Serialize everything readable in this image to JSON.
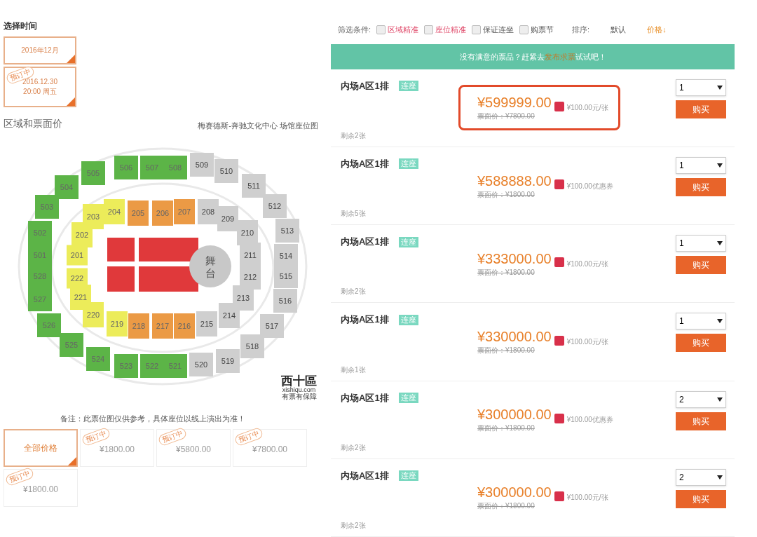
{
  "time_picker": {
    "title": "选择时间",
    "options": [
      {
        "lines": [
          "2016年12月"
        ],
        "selected": true
      },
      {
        "lines": [
          "2016.12.30",
          "20:00 周五"
        ],
        "selected": true,
        "stamp": "预订中"
      }
    ]
  },
  "area": {
    "title": "区域和票面价",
    "venue_link": "梅赛德斯-奔驰文化中心 场馆座位图"
  },
  "seat_map": {
    "stage": "舞台",
    "sections": [
      {
        "label": "505",
        "color": "#5cb447"
      },
      {
        "label": "506",
        "color": "#5cb447"
      },
      {
        "label": "507",
        "color": "#5cb447"
      },
      {
        "label": "508",
        "color": "#5cb447"
      },
      {
        "label": "509",
        "color": "#cfcfcf"
      },
      {
        "label": "510",
        "color": "#cfcfcf"
      },
      {
        "label": "504",
        "color": "#5cb447"
      },
      {
        "label": "511",
        "color": "#cfcfcf"
      },
      {
        "label": "503",
        "color": "#5cb447"
      },
      {
        "label": "203",
        "color": "#ecec5a"
      },
      {
        "label": "204",
        "color": "#ecec5a"
      },
      {
        "label": "205",
        "color": "#eb9a45"
      },
      {
        "label": "206",
        "color": "#eb9a45"
      },
      {
        "label": "207",
        "color": "#eb9a45"
      },
      {
        "label": "208",
        "color": "#cfcfcf"
      },
      {
        "label": "209",
        "color": "#cfcfcf"
      },
      {
        "label": "512",
        "color": "#cfcfcf"
      },
      {
        "label": "502",
        "color": "#5cb447"
      },
      {
        "label": "202",
        "color": "#ecec5a"
      },
      {
        "label": "210",
        "color": "#cfcfcf"
      },
      {
        "label": "513",
        "color": "#cfcfcf"
      },
      {
        "label": "501",
        "color": "#5cb447"
      },
      {
        "label": "201",
        "color": "#ecec5a"
      },
      {
        "label": "211",
        "color": "#cfcfcf"
      },
      {
        "label": "514",
        "color": "#cfcfcf"
      },
      {
        "label": "528",
        "color": "#5cb447"
      },
      {
        "label": "222",
        "color": "#ecec5a"
      },
      {
        "label": "212",
        "color": "#cfcfcf"
      },
      {
        "label": "515",
        "color": "#cfcfcf"
      },
      {
        "label": "527",
        "color": "#5cb447"
      },
      {
        "label": "221",
        "color": "#ecec5a"
      },
      {
        "label": "213",
        "color": "#cfcfcf"
      },
      {
        "label": "516",
        "color": "#cfcfcf"
      },
      {
        "label": "526",
        "color": "#5cb447"
      },
      {
        "label": "220",
        "color": "#ecec5a"
      },
      {
        "label": "219",
        "color": "#ecec5a"
      },
      {
        "label": "218",
        "color": "#eb9a45"
      },
      {
        "label": "217",
        "color": "#eb9a45"
      },
      {
        "label": "216",
        "color": "#eb9a45"
      },
      {
        "label": "215",
        "color": "#cfcfcf"
      },
      {
        "label": "214",
        "color": "#cfcfcf"
      },
      {
        "label": "517",
        "color": "#cfcfcf"
      },
      {
        "label": "525",
        "color": "#5cb447"
      },
      {
        "label": "518",
        "color": "#cfcfcf"
      },
      {
        "label": "524",
        "color": "#5cb447"
      },
      {
        "label": "523",
        "color": "#5cb447"
      },
      {
        "label": "522",
        "color": "#5cb447"
      },
      {
        "label": "521",
        "color": "#5cb447"
      },
      {
        "label": "520",
        "color": "#cfcfcf"
      },
      {
        "label": "519",
        "color": "#cfcfcf"
      }
    ],
    "logo": {
      "name": "西十區",
      "site": "xishiqu.com",
      "slogan": "有票有保障"
    }
  },
  "note": "备注：此票位图仅供参考，具体座位以线上演出为准！",
  "price_tabs": [
    {
      "label": "全部价格",
      "selected": true
    },
    {
      "label": "¥1800.00",
      "selected": false,
      "stamp": "预订中"
    },
    {
      "label": "¥5800.00",
      "selected": false,
      "stamp": "预订中"
    },
    {
      "label": "¥7800.00",
      "selected": false,
      "stamp": "预订中"
    },
    {
      "label": "¥1800.00",
      "selected": false,
      "stamp": "预订中"
    }
  ],
  "filters": {
    "label": "筛选条件:",
    "options": [
      {
        "label": "区域精准",
        "checked": false,
        "highlight": true
      },
      {
        "label": "座位精准",
        "checked": false,
        "highlight": true
      },
      {
        "label": "保证连坐",
        "checked": false,
        "highlight": false
      },
      {
        "label": "购票节",
        "checked": false,
        "highlight": false
      }
    ],
    "sort_label": "排序:",
    "sorts": [
      {
        "label": "默认",
        "selected": false
      },
      {
        "label": "价格↓",
        "selected": true
      }
    ]
  },
  "banner": {
    "before": "没有满意的票品？赶紧去",
    "link": "发布求票",
    "after": "试试吧！"
  },
  "listings": [
    {
      "title": "内场A区1排",
      "tag": "连座",
      "price": "¥599999.00",
      "perk": "¥100.00元/张",
      "face_value": "票面价：¥7800.00",
      "remaining": "剩余2张",
      "quantity": "1",
      "buy": "购买",
      "highlighted": true
    },
    {
      "title": "内场A区1排",
      "tag": "连座",
      "price": "¥588888.00",
      "perk": "¥100.00优惠券",
      "face_value": "票面价：¥1800.00",
      "remaining": "剩余5张",
      "quantity": "1",
      "buy": "购买",
      "highlighted": false
    },
    {
      "title": "内场A区1排",
      "tag": "连座",
      "price": "¥333000.00",
      "perk": "¥100.00元/张",
      "face_value": "票面价：¥1800.00",
      "remaining": "剩余2张",
      "quantity": "1",
      "buy": "购买",
      "highlighted": false
    },
    {
      "title": "内场A区1排",
      "tag": "连座",
      "price": "¥330000.00",
      "perk": "¥100.00元/张",
      "face_value": "票面价：¥1800.00",
      "remaining": "剩余1张",
      "quantity": "1",
      "buy": "购买",
      "highlighted": false
    },
    {
      "title": "内场A区1排",
      "tag": "连座",
      "price": "¥300000.00",
      "perk": "¥100.00优惠券",
      "face_value": "票面价：¥1800.00",
      "remaining": "剩余2张",
      "quantity": "2",
      "buy": "购买",
      "highlighted": false
    },
    {
      "title": "内场A区1排",
      "tag": "连座",
      "price": "¥300000.00",
      "perk": "¥100.00元/张",
      "face_value": "票面价：¥1800.00",
      "remaining": "剩余2张",
      "quantity": "2",
      "buy": "购买",
      "highlighted": false
    }
  ]
}
